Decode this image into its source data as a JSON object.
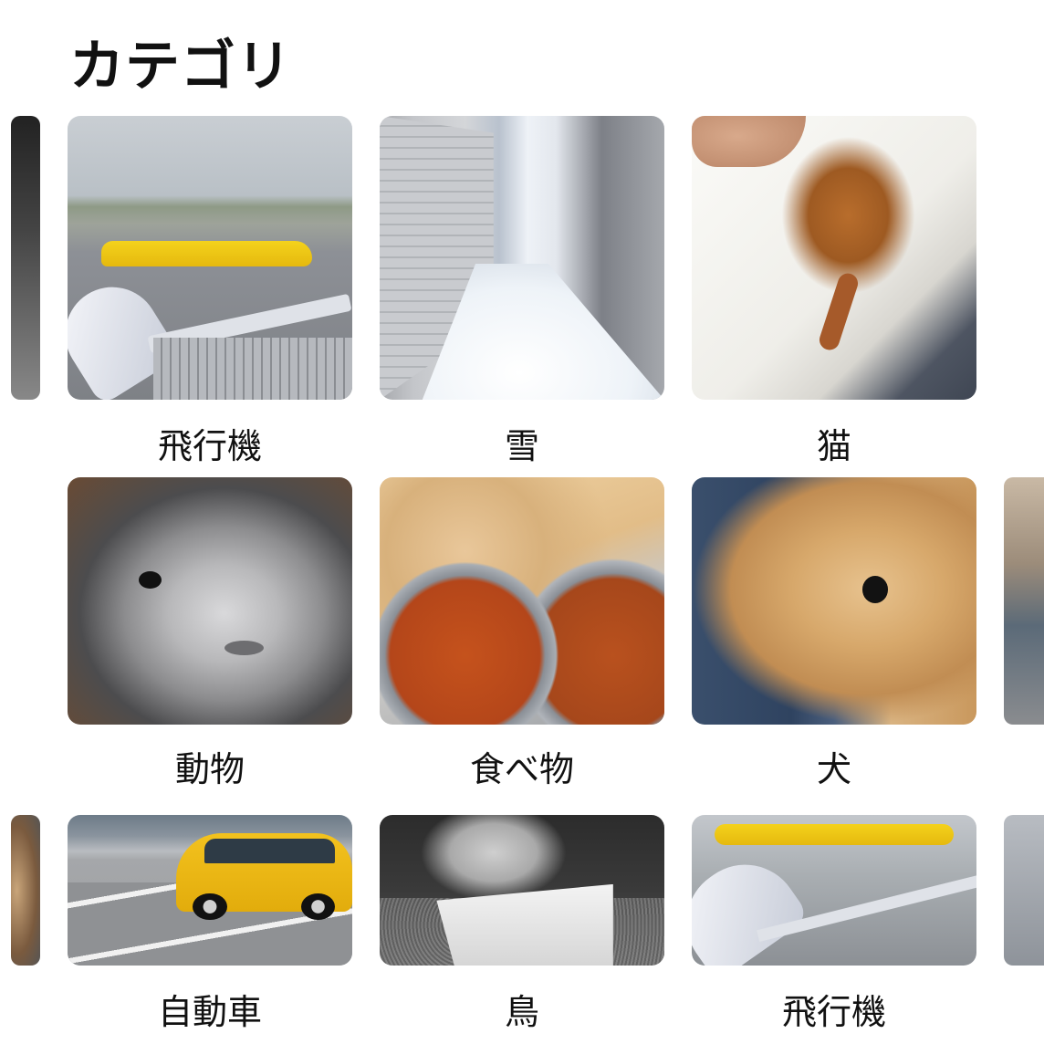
{
  "header": {
    "title": "カテゴリ"
  },
  "categories": [
    {
      "label": "飛行機",
      "icon": "airplane-photo"
    },
    {
      "label": "雪",
      "icon": "snow-photo"
    },
    {
      "label": "猫",
      "icon": "cat-photo"
    },
    {
      "label": "動物",
      "icon": "animal-photo"
    },
    {
      "label": "食べ物",
      "icon": "food-photo"
    },
    {
      "label": "犬",
      "icon": "dog-photo"
    },
    {
      "label": "自動車",
      "icon": "car-photo"
    },
    {
      "label": "鳥",
      "icon": "bird-photo"
    },
    {
      "label": "飛行機",
      "icon": "airplane-photo"
    }
  ],
  "colors": {
    "background": "#ffffff",
    "text": "#111111"
  }
}
